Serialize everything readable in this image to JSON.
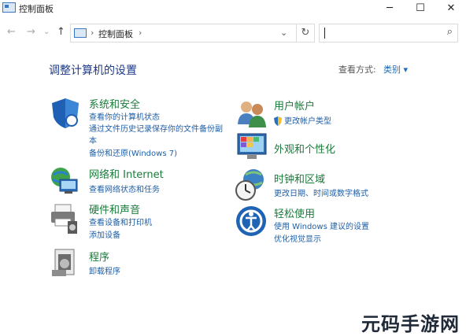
{
  "window": {
    "title": "控制面板",
    "minimize": "─",
    "maximize": "☐",
    "close": "✕"
  },
  "nav": {
    "back": "←",
    "forward": "→",
    "dropdown": "⌄",
    "up": "↑",
    "refresh": "↻"
  },
  "address": {
    "sep1": "›",
    "crumb": "控制面板",
    "sep2": "›",
    "dropdown": "⌄"
  },
  "search": {
    "icon": "⌕"
  },
  "heading": "调整计算机的设置",
  "view_by": {
    "label": "查看方式:",
    "value": "类别 ▾"
  },
  "categories": {
    "system": {
      "title": "系统和安全",
      "links": [
        "查看你的计算机状态",
        "通过文件历史记录保存你的文件备份副",
        "本",
        "备份和还原(Windows 7)"
      ]
    },
    "network": {
      "title": "网络和 Internet",
      "links": [
        "查看网络状态和任务"
      ]
    },
    "hardware": {
      "title": "硬件和声音",
      "links": [
        "查看设备和打印机",
        "添加设备"
      ]
    },
    "programs": {
      "title": "程序",
      "links": [
        "卸载程序"
      ]
    },
    "users": {
      "title": "用户帐户",
      "links": [
        "更改帐户类型"
      ]
    },
    "appearance": {
      "title": "外观和个性化",
      "links": []
    },
    "clock": {
      "title": "时钟和区域",
      "links": [
        "更改日期、时间或数字格式"
      ]
    },
    "ease": {
      "title": "轻松使用",
      "links": [
        "使用 Windows 建议的设置",
        "优化视觉显示"
      ]
    }
  },
  "watermark": "元码手游网"
}
